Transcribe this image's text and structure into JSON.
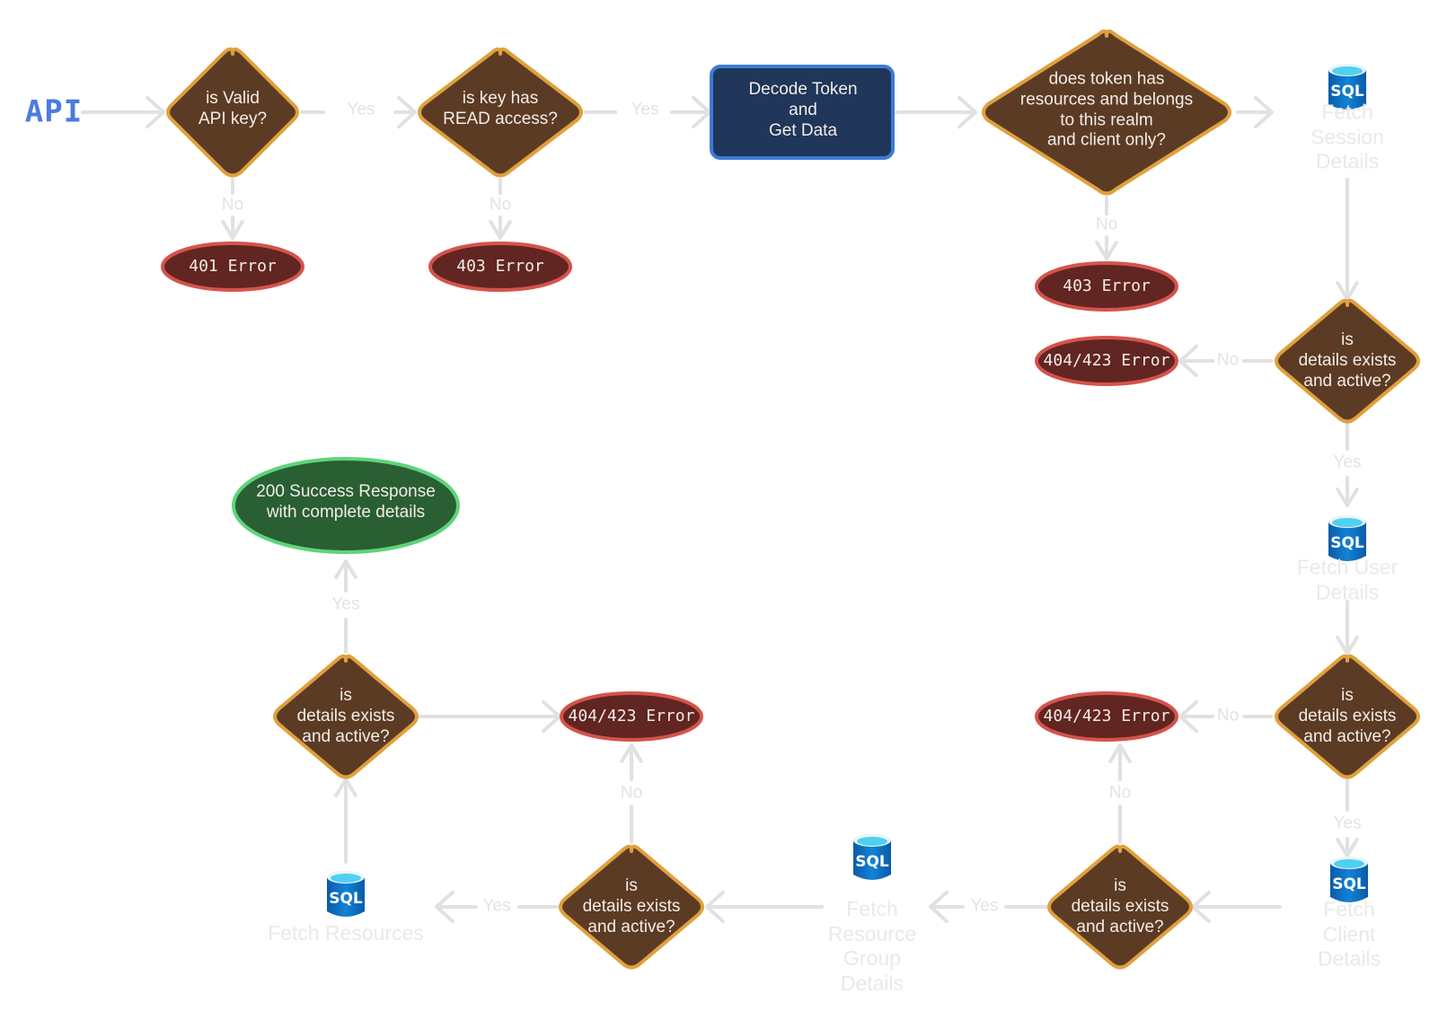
{
  "colors": {
    "decision_fill": "#5c3b25",
    "decision_stroke": "#e0a03c",
    "error_fill": "#612522",
    "error_stroke": "#d5534c",
    "process_fill": "#20365a",
    "process_stroke": "#3d7bd6",
    "success_fill": "#2a5e33",
    "success_stroke": "#5ed47a",
    "edge": "#e1e1e1",
    "db_blue": "#0a6fc2",
    "db_top": "#50d0f0",
    "api": "#4c7be0"
  },
  "nodes": {
    "api": {
      "label": "API"
    },
    "valid_key": {
      "label": "is Valid\nAPI key?"
    },
    "read_access": {
      "label": "is key has\nREAD access?"
    },
    "decode_token": {
      "label": "Decode Token\nand\nGet Data"
    },
    "token_check": {
      "label": "does token has\nresources and belongs\nto this realm\nand client only?"
    },
    "err_401": {
      "label": "401 Error"
    },
    "err_403_a": {
      "label": "403 Error"
    },
    "err_403_b": {
      "label": "403 Error"
    },
    "fetch_session": {
      "label": "Fetch Session\nDetails",
      "icon": "SQL"
    },
    "session_check": {
      "label": "is\ndetails exists\nand active?"
    },
    "err_404_session": {
      "label": "404/423 Error"
    },
    "fetch_user": {
      "label": "Fetch User Details",
      "icon": "SQL"
    },
    "user_check": {
      "label": "is\ndetails exists\nand active?"
    },
    "err_404_user": {
      "label": "404/423 Error"
    },
    "fetch_client": {
      "label": "Fetch\nClient Details",
      "icon": "SQL"
    },
    "client_check": {
      "label": "is\ndetails exists\nand active?"
    },
    "fetch_resource_group": {
      "label": "Fetch\nResource\nGroup\nDetails",
      "icon": "SQL"
    },
    "rg_check": {
      "label": "is\ndetails exists\nand active?"
    },
    "err_404_rg": {
      "label": "404/423 Error"
    },
    "fetch_resources": {
      "label": "Fetch Resources",
      "icon": "SQL"
    },
    "resources_check": {
      "label": "is\ndetails exists\nand active?"
    },
    "success": {
      "label": "200 Success Response\nwith complete details"
    }
  },
  "edges": {
    "yes": "Yes",
    "no": "No"
  }
}
